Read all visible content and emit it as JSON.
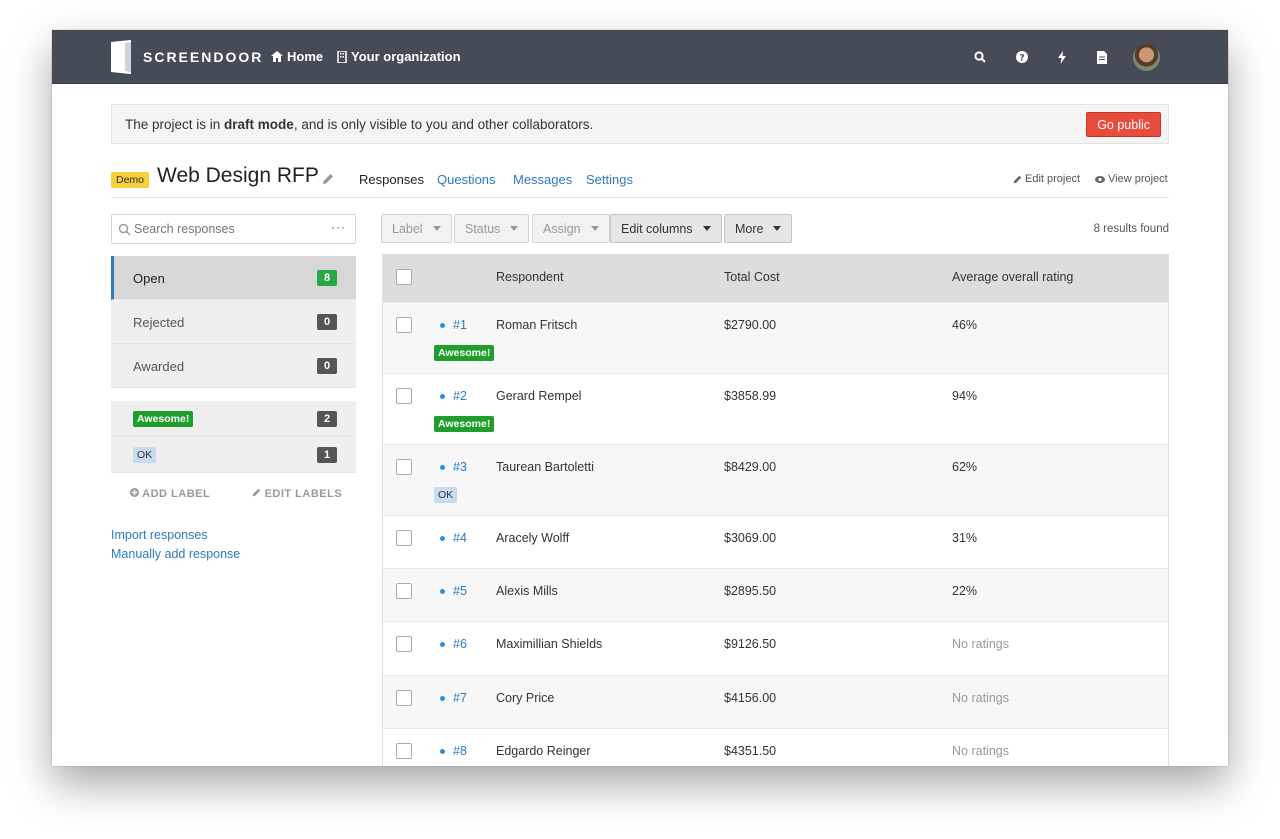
{
  "nav": {
    "brand": "SCREENDOOR",
    "home": "Home",
    "org": "Your organization",
    "icons": [
      "search-icon",
      "help-icon",
      "bolt-icon",
      "document-icon",
      "avatar"
    ]
  },
  "banner": {
    "prefix": "The project is in ",
    "bold": "draft mode",
    "suffix": ", and is only visible to you and other collaborators.",
    "button": "Go public"
  },
  "project": {
    "badge": "Demo",
    "title": "Web Design RFP",
    "tabs": [
      "Responses",
      "Questions",
      "Messages",
      "Settings"
    ],
    "edit": "Edit project",
    "view": "View project"
  },
  "sidebar": {
    "search_placeholder": "Search responses",
    "more": "···",
    "statuses": [
      {
        "label": "Open",
        "count": "8"
      },
      {
        "label": "Rejected",
        "count": "0"
      },
      {
        "label": "Awarded",
        "count": "0"
      }
    ],
    "labels": [
      {
        "label": "Awesome!",
        "count": "2"
      },
      {
        "label": "OK",
        "count": "1"
      }
    ],
    "add_label": "ADD LABEL",
    "edit_labels": "EDIT LABELS",
    "import": "Import responses",
    "manual": "Manually add response"
  },
  "toolbar": {
    "label": "Label",
    "status": "Status",
    "assign": "Assign",
    "edit_columns": "Edit columns",
    "more": "More",
    "results": "8 results found"
  },
  "table": {
    "headers": [
      "Respondent",
      "Total Cost",
      "Average overall rating"
    ],
    "rows": [
      {
        "id": "#1",
        "name": "Roman Fritsch",
        "cost": "$2790.00",
        "rating": "46%",
        "label": "Awesome!"
      },
      {
        "id": "#2",
        "name": "Gerard Rempel",
        "cost": "$3858.99",
        "rating": "94%",
        "label": "Awesome!"
      },
      {
        "id": "#3",
        "name": "Taurean Bartoletti",
        "cost": "$8429.00",
        "rating": "62%",
        "label": "OK"
      },
      {
        "id": "#4",
        "name": "Aracely Wolff",
        "cost": "$3069.00",
        "rating": "31%",
        "label": ""
      },
      {
        "id": "#5",
        "name": "Alexis Mills",
        "cost": "$2895.50",
        "rating": "22%",
        "label": ""
      },
      {
        "id": "#6",
        "name": "Maximillian Shields",
        "cost": "$9126.50",
        "rating": "No ratings",
        "label": ""
      },
      {
        "id": "#7",
        "name": "Cory Price",
        "cost": "$4156.00",
        "rating": "No ratings",
        "label": ""
      },
      {
        "id": "#8",
        "name": "Edgardo Reinger",
        "cost": "$4351.50",
        "rating": "No ratings",
        "label": ""
      }
    ]
  },
  "colors": {
    "nav_bg": "#454c57",
    "link": "#2b7bbf",
    "go_public": "#e74c3c",
    "awesome": "#1f9e2c",
    "ok": "#c8dcf0",
    "demo": "#f5d03b"
  }
}
